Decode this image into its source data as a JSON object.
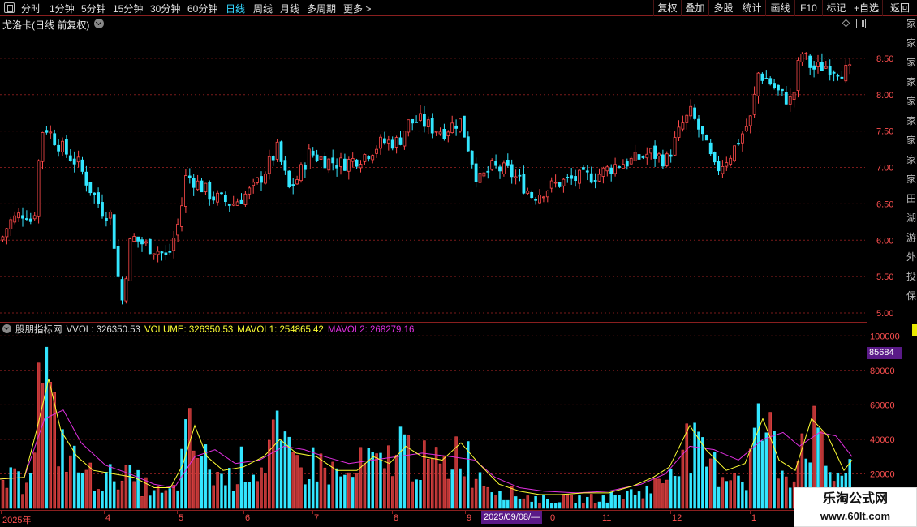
{
  "toolbar": {
    "periods": [
      "分时",
      "1分钟",
      "5分钟",
      "15分钟",
      "30分钟",
      "60分钟",
      "日线",
      "周线",
      "月线",
      "多周期",
      "更多 >"
    ],
    "active_period": "日线",
    "right_buttons": [
      "复权",
      "叠加",
      "多股",
      "统计",
      "画线",
      "F10",
      "标记",
      "+自选",
      "返回"
    ]
  },
  "stock": {
    "title": "尤洛卡(日线 前复权)"
  },
  "volume_panel": {
    "indicator_name": "股朋指标网",
    "vvol_label": "VVOL: 326350.53",
    "volume_label": "VOLUME: 326350.53",
    "mavol1_label": "MAVOL1: 254865.42",
    "mavol2_label": "MAVOL2: 268279.16",
    "cursor_value": "85684"
  },
  "dates": {
    "labels": [
      "2025年",
      "4",
      "5",
      "6",
      "7",
      "8",
      "9",
      "0",
      "11",
      "12",
      "1"
    ],
    "cursor_date": "2025/09/08/—"
  },
  "right_strip_glyphs": "家家家家家家家家家田湖游外投保",
  "watermark": {
    "title": "乐淘公式网",
    "url": "www.60lt.com"
  },
  "colors": {
    "up": "#ff4a4a",
    "down": "#33e6ff",
    "mavol1": "#ffff33",
    "mavol2": "#e030e0",
    "grid": "#7a1a1a",
    "axis_text": "#ff5050",
    "active_tab": "#33d6ff"
  },
  "chart_data": [
    {
      "type": "candlestick",
      "title": "尤洛卡(日线 前复权)",
      "y_ticks": [
        5.0,
        5.5,
        6.0,
        6.5,
        7.0,
        7.5,
        8.0,
        8.5
      ],
      "ylim": [
        4.9,
        8.8
      ],
      "x_labels": [
        "2025年",
        "4",
        "5",
        "6",
        "7",
        "8",
        "9",
        "0",
        "11",
        "12",
        "1"
      ],
      "close_path": [
        [
          0,
          6.0
        ],
        [
          10,
          6.25
        ],
        [
          30,
          6.4
        ],
        [
          40,
          6.2
        ],
        [
          44,
          6.9
        ],
        [
          52,
          7.6
        ],
        [
          65,
          7.4
        ],
        [
          80,
          7.2
        ],
        [
          95,
          7.05
        ],
        [
          110,
          6.7
        ],
        [
          125,
          6.4
        ],
        [
          135,
          6.35
        ],
        [
          142,
          5.7
        ],
        [
          148,
          5.1
        ],
        [
          160,
          6.05
        ],
        [
          175,
          5.95
        ],
        [
          195,
          5.85
        ],
        [
          205,
          5.75
        ],
        [
          220,
          6.3
        ],
        [
          228,
          6.9
        ],
        [
          240,
          6.8
        ],
        [
          260,
          6.6
        ],
        [
          285,
          6.5
        ],
        [
          310,
          6.7
        ],
        [
          325,
          6.95
        ],
        [
          340,
          7.25
        ],
        [
          355,
          6.7
        ],
        [
          365,
          6.85
        ],
        [
          380,
          7.2
        ],
        [
          400,
          7.1
        ],
        [
          420,
          7.05
        ],
        [
          445,
          7.15
        ],
        [
          470,
          7.35
        ],
        [
          490,
          7.35
        ],
        [
          500,
          7.6
        ],
        [
          515,
          7.65
        ],
        [
          530,
          7.55
        ],
        [
          545,
          7.5
        ],
        [
          565,
          7.65
        ],
        [
          575,
          7.3
        ],
        [
          588,
          6.8
        ],
        [
          605,
          7.0
        ],
        [
          625,
          6.95
        ],
        [
          640,
          6.8
        ],
        [
          655,
          6.6
        ],
        [
          670,
          6.7
        ],
        [
          690,
          6.8
        ],
        [
          710,
          6.85
        ],
        [
          735,
          6.9
        ],
        [
          760,
          7.05
        ],
        [
          780,
          7.1
        ],
        [
          800,
          7.2
        ],
        [
          820,
          7.1
        ],
        [
          840,
          7.6
        ],
        [
          850,
          7.75
        ],
        [
          865,
          7.4
        ],
        [
          880,
          6.95
        ],
        [
          900,
          7.2
        ],
        [
          915,
          7.5
        ],
        [
          925,
          7.7
        ],
        [
          932,
          8.3
        ],
        [
          945,
          8.2
        ],
        [
          960,
          8.0
        ],
        [
          975,
          7.9
        ],
        [
          985,
          8.6
        ],
        [
          1000,
          8.35
        ],
        [
          1015,
          8.4
        ],
        [
          1030,
          8.35
        ],
        [
          1048,
          8.3
        ]
      ]
    },
    {
      "type": "bar",
      "title": "股朋指标网",
      "y_ticks": [
        20000,
        40000,
        60000,
        80000,
        100000
      ],
      "ylim": [
        0,
        102000
      ],
      "series": [
        {
          "name": "VVOL",
          "bar_profile": [
            [
              0,
              17000
            ],
            [
              30,
              17000
            ],
            [
              42,
              55000
            ],
            [
              52,
              97000
            ],
            [
              62,
              55000
            ],
            [
              75,
              40000
            ],
            [
              90,
              28000
            ],
            [
              110,
              20000
            ],
            [
              130,
              17000
            ],
            [
              145,
              24000
            ],
            [
              160,
              18000
            ],
            [
              185,
              12000
            ],
            [
              200,
              8000
            ],
            [
              215,
              12000
            ],
            [
              230,
              45000
            ],
            [
              240,
              38000
            ],
            [
              260,
              22000
            ],
            [
              280,
              18000
            ],
            [
              300,
              28000
            ],
            [
              320,
              24000
            ],
            [
              335,
              46000
            ],
            [
              350,
              32000
            ],
            [
              370,
              26000
            ],
            [
              390,
              28000
            ],
            [
              410,
              22000
            ],
            [
              430,
              18000
            ],
            [
              450,
              30000
            ],
            [
              470,
              24000
            ],
            [
              490,
              42000
            ],
            [
              510,
              30000
            ],
            [
              530,
              27000
            ],
            [
              550,
              26000
            ],
            [
              565,
              42000
            ],
            [
              580,
              25000
            ],
            [
              600,
              16000
            ],
            [
              620,
              10000
            ],
            [
              640,
              8000
            ],
            [
              660,
              6000
            ],
            [
              680,
              5000
            ],
            [
              700,
              6000
            ],
            [
              720,
              6000
            ],
            [
              740,
              6000
            ],
            [
              760,
              8000
            ],
            [
              780,
              10000
            ],
            [
              800,
              12000
            ],
            [
              820,
              20000
            ],
            [
              835,
              40000
            ],
            [
              850,
              38000
            ],
            [
              870,
              28000
            ],
            [
              890,
              22000
            ],
            [
              905,
              24000
            ],
            [
              918,
              18000
            ],
            [
              930,
              50000
            ],
            [
              945,
              50000
            ],
            [
              960,
              24000
            ],
            [
              975,
              22000
            ],
            [
              990,
              50000
            ],
            [
              1002,
              45000
            ],
            [
              1015,
              28000
            ],
            [
              1030,
              20000
            ],
            [
              1048,
              30000
            ]
          ]
        },
        {
          "name": "MAVOL1",
          "path": [
            [
              0,
              17000
            ],
            [
              30,
              18000
            ],
            [
              45,
              45000
            ],
            [
              60,
              75000
            ],
            [
              75,
              45000
            ],
            [
              95,
              30000
            ],
            [
              115,
              22000
            ],
            [
              140,
              20000
            ],
            [
              165,
              18000
            ],
            [
              190,
              12000
            ],
            [
              210,
              12000
            ],
            [
              225,
              25000
            ],
            [
              240,
              48000
            ],
            [
              255,
              30000
            ],
            [
              275,
              22000
            ],
            [
              300,
              24000
            ],
            [
              325,
              30000
            ],
            [
              345,
              40000
            ],
            [
              365,
              32000
            ],
            [
              390,
              30000
            ],
            [
              415,
              22000
            ],
            [
              440,
              22000
            ],
            [
              460,
              30000
            ],
            [
              480,
              26000
            ],
            [
              500,
              36000
            ],
            [
              520,
              30000
            ],
            [
              545,
              28000
            ],
            [
              568,
              38000
            ],
            [
              590,
              26000
            ],
            [
              615,
              14000
            ],
            [
              640,
              10000
            ],
            [
              665,
              8000
            ],
            [
              690,
              8000
            ],
            [
              720,
              9000
            ],
            [
              750,
              9000
            ],
            [
              780,
              13000
            ],
            [
              805,
              18000
            ],
            [
              825,
              24000
            ],
            [
              850,
              48000
            ],
            [
              870,
              34000
            ],
            [
              895,
              22000
            ],
            [
              918,
              26000
            ],
            [
              940,
              52000
            ],
            [
              960,
              28000
            ],
            [
              980,
              22000
            ],
            [
              1000,
              52000
            ],
            [
              1020,
              42000
            ],
            [
              1040,
              22000
            ],
            [
              1050,
              28000
            ]
          ]
        },
        {
          "name": "MAVOL2",
          "path": [
            [
              0,
              17000
            ],
            [
              30,
              18000
            ],
            [
              55,
              52000
            ],
            [
              78,
              57000
            ],
            [
              100,
              38000
            ],
            [
              130,
              25000
            ],
            [
              160,
              20000
            ],
            [
              190,
              14000
            ],
            [
              215,
              12000
            ],
            [
              240,
              30000
            ],
            [
              265,
              34000
            ],
            [
              290,
              26000
            ],
            [
              320,
              28000
            ],
            [
              350,
              36000
            ],
            [
              375,
              34000
            ],
            [
              400,
              30000
            ],
            [
              430,
              26000
            ],
            [
              460,
              28000
            ],
            [
              490,
              30000
            ],
            [
              520,
              32000
            ],
            [
              555,
              30000
            ],
            [
              585,
              28000
            ],
            [
              610,
              18000
            ],
            [
              640,
              12000
            ],
            [
              670,
              10000
            ],
            [
              710,
              9000
            ],
            [
              750,
              10000
            ],
            [
              790,
              14000
            ],
            [
              820,
              20000
            ],
            [
              850,
              36000
            ],
            [
              880,
              34000
            ],
            [
              910,
              28000
            ],
            [
              940,
              40000
            ],
            [
              965,
              44000
            ],
            [
              985,
              36000
            ],
            [
              1010,
              44000
            ],
            [
              1030,
              42000
            ],
            [
              1050,
              30000
            ]
          ]
        }
      ]
    }
  ]
}
